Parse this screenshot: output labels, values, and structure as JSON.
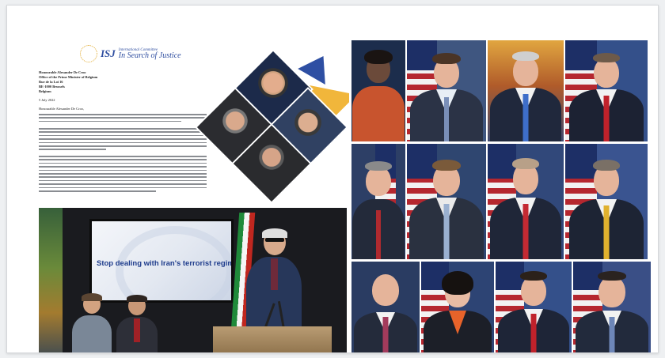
{
  "letter": {
    "logo_isj": "ISJ",
    "logo_subtitle": "International Committee",
    "logo_title": "In Search of Justice",
    "recipient_name": "Honourable Alexander De Croo",
    "recipient_office": "Office of the Prime Minister of Belgium",
    "street": "Rue de la Loi 16",
    "city": "BE-1000 Brussels",
    "country": "Belgium",
    "date": "5 July 2022",
    "salutation": "Honourable Alexander De Croo,"
  },
  "conference": {
    "screen_text": "Stop dealing with Iran's terrorist regime"
  },
  "colors": {
    "screen_text": "#1e3c8c",
    "logo": "#2f4ea0"
  }
}
